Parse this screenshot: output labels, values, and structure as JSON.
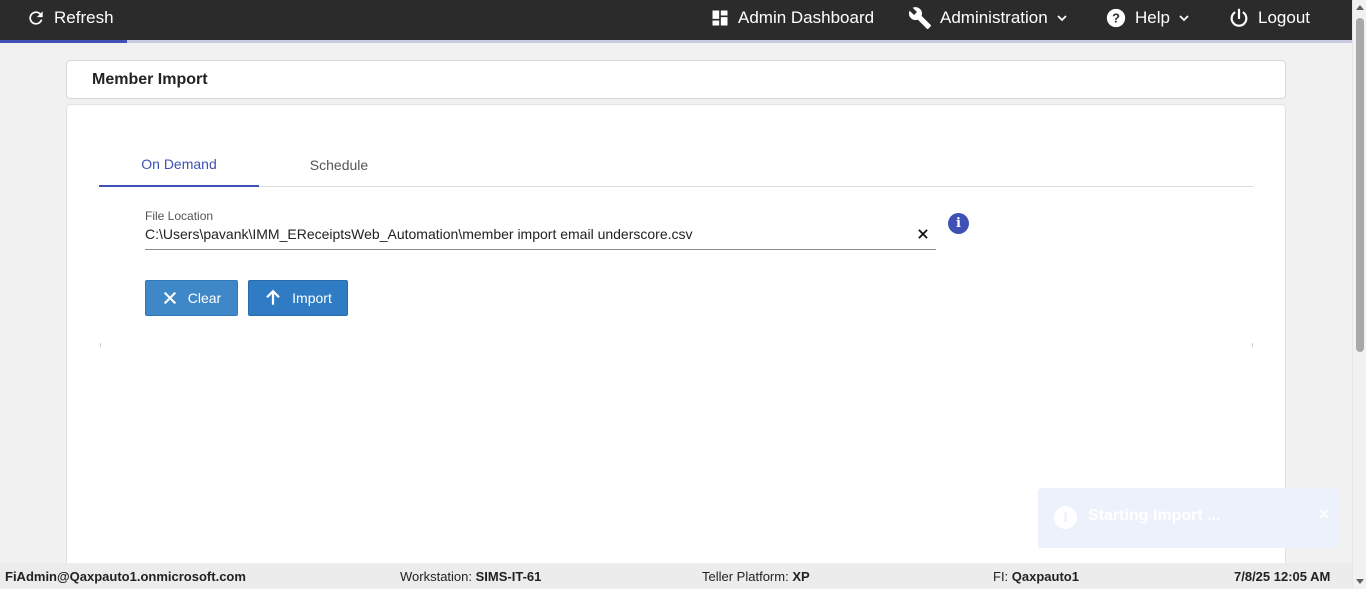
{
  "topbar": {
    "refresh_label": "Refresh",
    "admin_dashboard_label": "Admin Dashboard",
    "administration_label": "Administration",
    "help_label": "Help",
    "logout_label": "Logout",
    "loading_progress": 0.094
  },
  "page": {
    "title": "Member Import"
  },
  "tabs": [
    {
      "label": "On Demand",
      "active": true
    },
    {
      "label": "Schedule",
      "active": false
    }
  ],
  "form": {
    "file_location_label": "File Location",
    "file_location_value": "C:\\Users\\pavank\\IMM_EReceiptsWeb_Automation\\member import email underscore.csv",
    "info_icon": "info-icon"
  },
  "buttons": {
    "clear_label": "Clear",
    "import_label": "Import"
  },
  "toast": {
    "message": "Starting Import ...",
    "close": "×"
  },
  "statusbar": {
    "user": "FiAdmin@Qaxpauto1.onmicrosoft.com",
    "workstation_label": "Workstation:",
    "workstation_value": "SIMS-IT-61",
    "teller_platform_label": "Teller Platform:",
    "teller_platform_value": "XP",
    "fi_label": "FI:",
    "fi_value": "Qaxpauto1",
    "datetime": "7/8/25 12:05 AM"
  },
  "colors": {
    "primary": "#3f51b5",
    "button": "#3f88c8",
    "topbar": "#2b2b2b"
  }
}
